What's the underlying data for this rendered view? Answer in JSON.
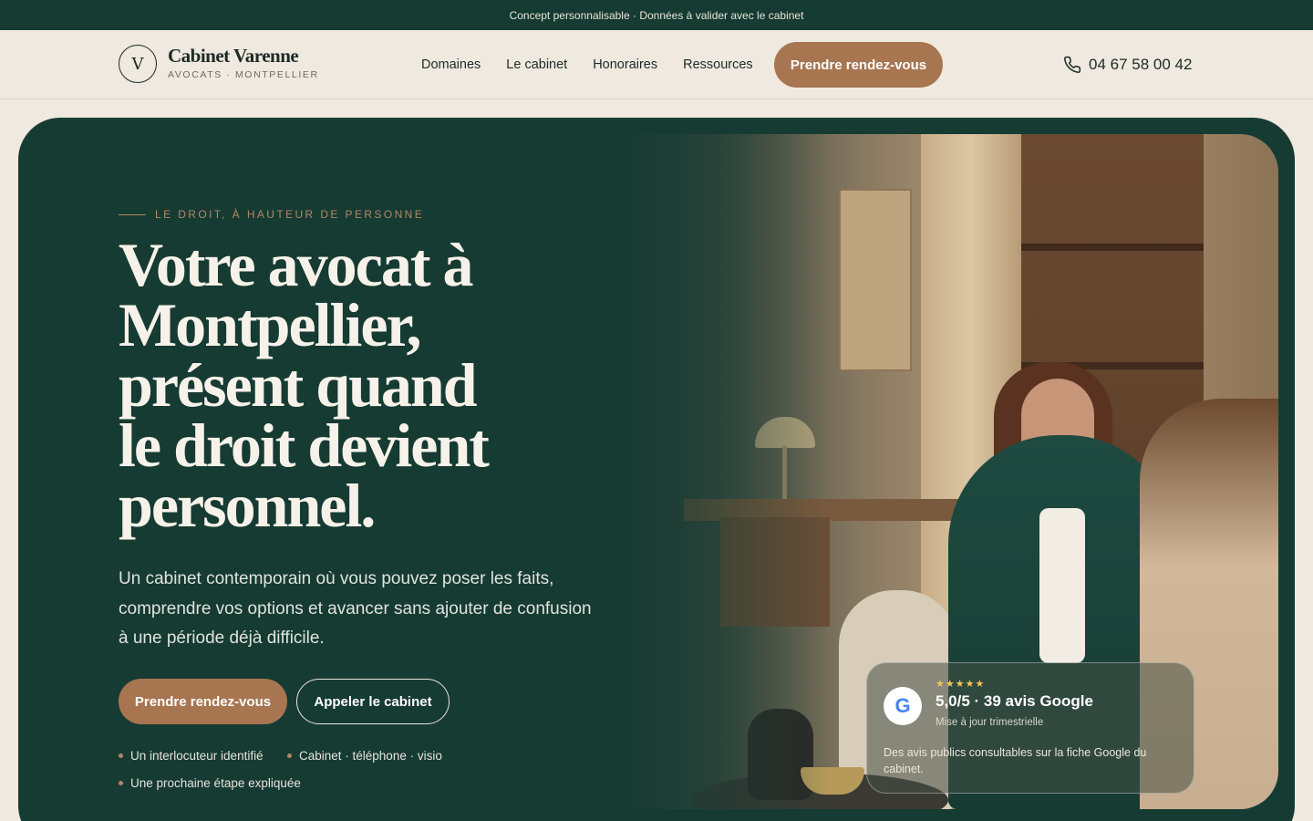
{
  "topbar": {
    "notice": "Concept personnalisable · Données à valider avec le cabinet"
  },
  "header": {
    "logo_letter": "V",
    "brand_name": "Cabinet Varenne",
    "brand_sub": "AVOCATS · MONTPELLIER",
    "nav": [
      "Domaines",
      "Le cabinet",
      "Honoraires",
      "Ressources"
    ],
    "cta_label": "Prendre rendez-vous",
    "phone": "04 67 58 00 42"
  },
  "hero": {
    "eyebrow": "LE DROIT, À HAUTEUR DE PERSONNE",
    "headline_lines": [
      "Votre avocat à",
      "Montpellier,",
      "présent quand",
      "le droit devient",
      "personnel."
    ],
    "lead": "Un cabinet contemporain où vous pouvez poser les faits, comprendre vos options et avancer sans ajouter de confusion à une période déjà difficile.",
    "primary_button": "Prendre rendez-vous",
    "secondary_button": "Appeler le cabinet",
    "bullets": [
      "Un interlocuteur identifié",
      "Cabinet · téléphone · visio",
      "Une prochaine étape expliquée"
    ]
  },
  "review": {
    "badge": "G",
    "stars": "★★★★★",
    "rating": "5,0/5 · 39 avis Google",
    "updated": "Mise à jour trimestrielle",
    "description": "Des avis publics consultables sur la fiche Google du cabinet."
  },
  "colors": {
    "dark_green": "#163b33",
    "accent_copper": "#a87551",
    "cream": "#efe9df"
  }
}
